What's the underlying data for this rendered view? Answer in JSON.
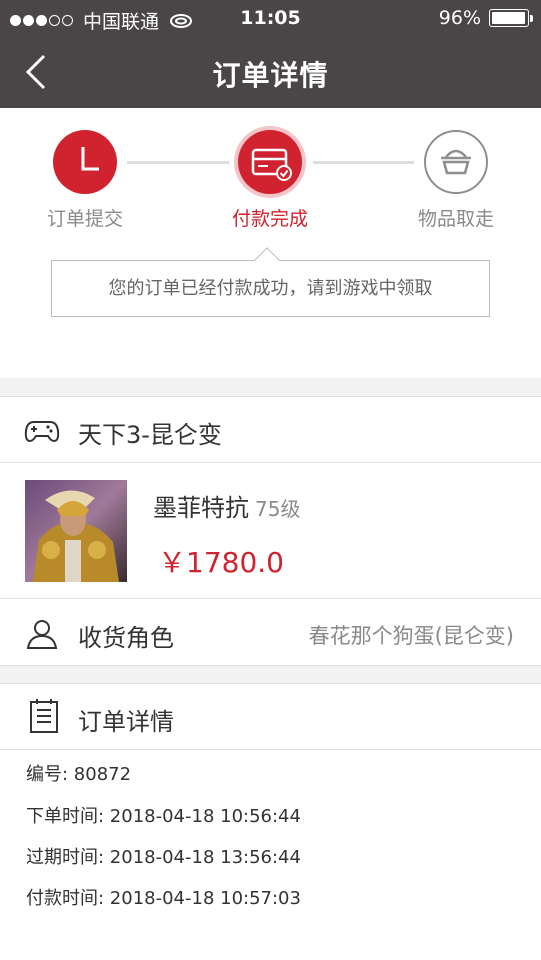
{
  "status_bar": {
    "carrier": "中国联通",
    "time": "11:05",
    "battery": "96%",
    "battery_level": 0.96
  },
  "nav": {
    "title": "订单详情"
  },
  "steps": [
    {
      "label": "订单提交",
      "state": "done",
      "icon": "clock-icon"
    },
    {
      "label": "付款完成",
      "state": "current",
      "icon": "card-paid-icon"
    },
    {
      "label": "物品取走",
      "state": "pending",
      "icon": "basket-icon"
    }
  ],
  "tip": "您的订单已经付款成功，请到游戏中领取",
  "game": {
    "icon": "gamepad-icon",
    "title": "天下3-昆仑变"
  },
  "product": {
    "name": "墨菲特抗",
    "level": "75级",
    "price": "￥1780.0"
  },
  "role": {
    "icon": "user-icon",
    "label": "收货角色",
    "value": "春花那个狗蛋(昆仑变)"
  },
  "order": {
    "icon": "document-icon",
    "label": "订单详情",
    "lines": [
      "编号: 80872",
      "下单时间: 2018-04-18 10:56:44",
      "过期时间: 2018-04-18 13:56:44",
      "付款时间: 2018-04-18 10:57:03"
    ]
  },
  "colors": {
    "header": "#4a4648",
    "accent": "#d0232f"
  }
}
